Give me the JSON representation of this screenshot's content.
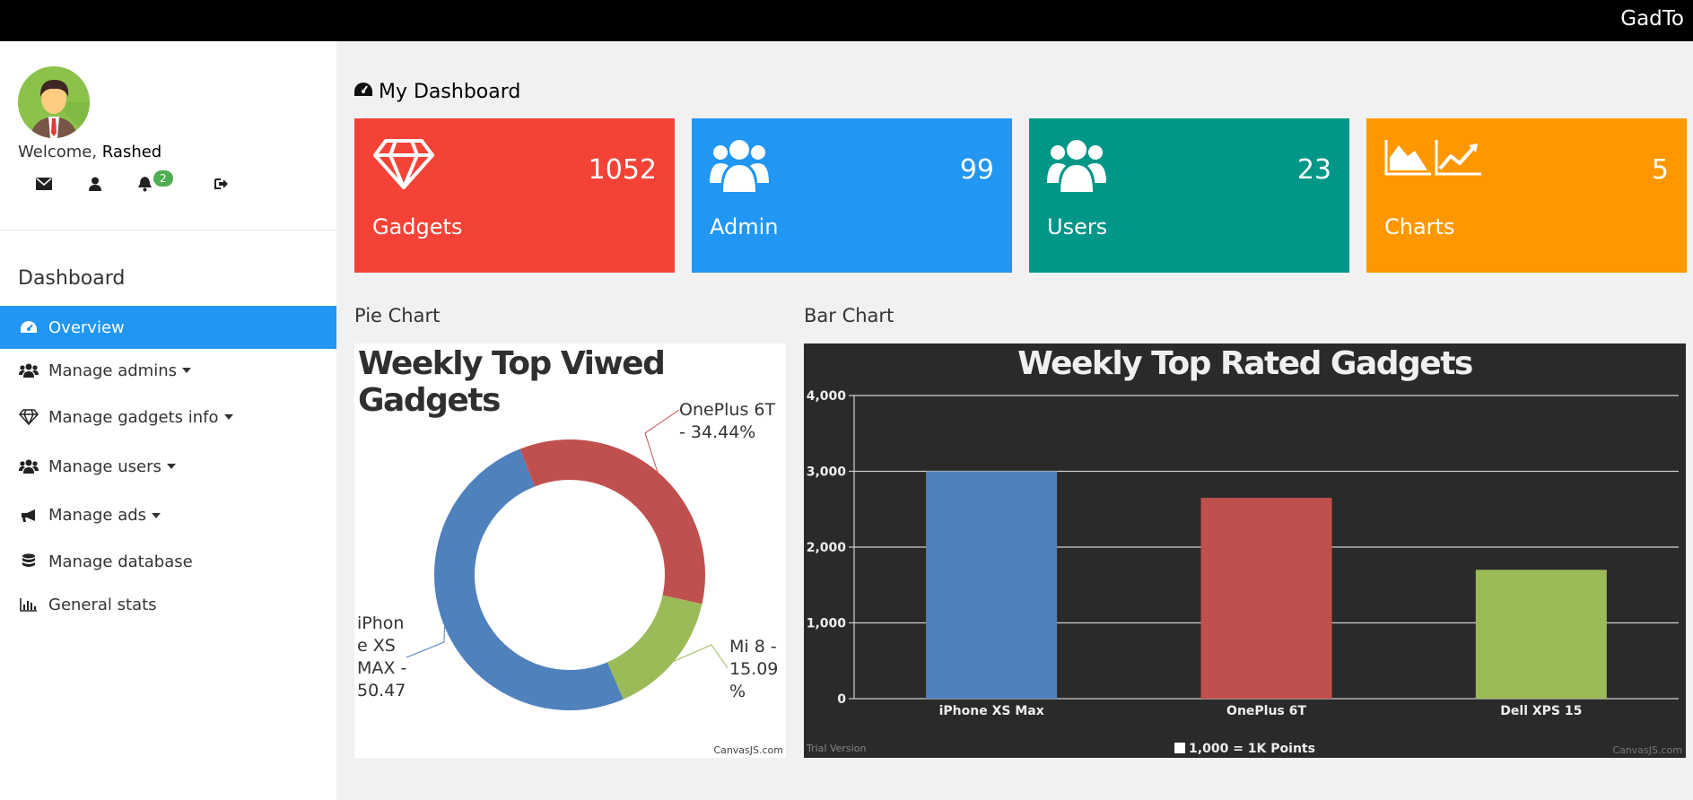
{
  "app": {
    "brand": "GadTo"
  },
  "user": {
    "welcome_prefix": "Welcome,",
    "name": "Rashed",
    "notifications": "2"
  },
  "sidebar": {
    "title": "Dashboard",
    "items": [
      {
        "label": "Overview",
        "icon": "dashboard-icon",
        "active": true
      },
      {
        "label": "Manage admins",
        "icon": "users-icon",
        "dropdown": true
      },
      {
        "label": "Manage gadgets info",
        "icon": "diamond-icon",
        "dropdown": true
      },
      {
        "label": "Manage users",
        "icon": "users-icon",
        "dropdown": true
      },
      {
        "label": "Manage ads",
        "icon": "bullhorn-icon",
        "dropdown": true
      },
      {
        "label": "Manage database",
        "icon": "database-icon"
      },
      {
        "label": "General stats",
        "icon": "bar-chart-icon"
      }
    ]
  },
  "main": {
    "title": "My Dashboard"
  },
  "cards": [
    {
      "label": "Gadgets",
      "value": "1052",
      "color": "#f44336",
      "icon": "diamond-icon"
    },
    {
      "label": "Admin",
      "value": "99",
      "color": "#2196f3",
      "icon": "users-icon"
    },
    {
      "label": "Users",
      "value": "23",
      "color": "#009688",
      "icon": "users-icon"
    },
    {
      "label": "Charts",
      "value": "5",
      "color": "#ff9800",
      "icon": "chart-icons"
    }
  ],
  "sections": {
    "pie": "Pie Chart",
    "bar": "Bar Chart"
  },
  "pie": {
    "credit": "CanvasJS.com",
    "labels": [
      {
        "lines": [
          "OnePlus 6T",
          "- 34.44%"
        ]
      },
      {
        "lines": [
          "Mi 8 -",
          "15.09",
          "%"
        ]
      },
      {
        "lines": [
          "iPhon",
          "e XS",
          "MAX -",
          "50.47"
        ]
      }
    ]
  },
  "bar": {
    "credit": "CanvasJS.com",
    "trial": "Trial Version",
    "legend": "1,000 = 1K Points"
  },
  "chart_data": [
    {
      "type": "pie",
      "title": "Weekly Top Viwed Gadgets",
      "series": [
        {
          "name": "OnePlus 6T",
          "value": 34.44,
          "color": "#c0504d"
        },
        {
          "name": "Mi 8",
          "value": 15.09,
          "color": "#9bbb59"
        },
        {
          "name": "iPhone XS MAX",
          "value": 50.47,
          "color": "#4f81bd"
        }
      ]
    },
    {
      "type": "bar",
      "title": "Weekly Top Rated Gadgets",
      "categories": [
        "iPhone XS Max",
        "OnePlus 6T",
        "Dell XPS 15"
      ],
      "values": [
        3000,
        2650,
        1700
      ],
      "colors": [
        "#4f81bd",
        "#c0504d",
        "#9bbb59"
      ],
      "ylim": [
        0,
        4000
      ],
      "yticks": [
        0,
        1000,
        2000,
        3000,
        4000
      ],
      "ytick_labels": [
        "0",
        "1,000",
        "2,000",
        "3,000",
        "4,000"
      ],
      "grid": true,
      "legend": "bottom-center"
    }
  ]
}
